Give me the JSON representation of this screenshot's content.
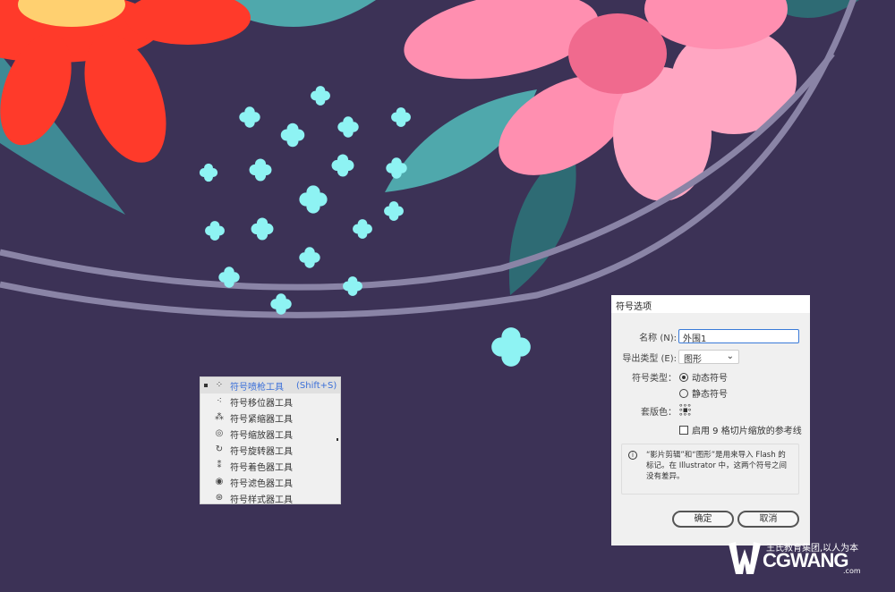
{
  "colors": {
    "background": "#3c3256",
    "cyan_shapes": "#8ef3f3",
    "red_flower": "#ff3a2a",
    "pink_flower": "#ff8fb0",
    "leaf": "#4fa8ac",
    "accent": "#3a6fd8"
  },
  "tool_menu": {
    "items": [
      {
        "label": "符号喷枪工具",
        "shortcut": "(Shift+S)",
        "icon": "symbol-sprayer-icon",
        "selected": true
      },
      {
        "label": "符号移位器工具",
        "icon": "symbol-shifter-icon"
      },
      {
        "label": "符号紧缩器工具",
        "icon": "symbol-scruncher-icon"
      },
      {
        "label": "符号缩放器工具",
        "icon": "symbol-sizer-icon"
      },
      {
        "label": "符号旋转器工具",
        "icon": "symbol-spinner-icon"
      },
      {
        "label": "符号着色器工具",
        "icon": "symbol-stainer-icon"
      },
      {
        "label": "符号滤色器工具",
        "icon": "symbol-screener-icon"
      },
      {
        "label": "符号样式器工具",
        "icon": "symbol-styler-icon"
      }
    ]
  },
  "dialog": {
    "title": "符号选项",
    "name_label": "名称 (N):",
    "name_value": "外围1",
    "export_label": "导出类型 (E):",
    "export_value": "图形",
    "symbol_type_label": "符号类型：",
    "dynamic_label": "动态符号",
    "static_label": "静态符号",
    "symbol_type_selected": "动态符号",
    "registration_label": "套版色：",
    "nine_slice_label": "启用 9 格切片缩放的参考线",
    "nine_slice_checked": false,
    "info_text": "“影片剪辑”和“图形”是用来导入 Flash 的标记。在 Illustrator 中，这两个符号之间没有差异。",
    "ok": "确定",
    "cancel": "取消"
  },
  "watermark": {
    "tagline": "王氏教育集团,以人为本",
    "brand": "CGWANG",
    "domain": ".com"
  }
}
